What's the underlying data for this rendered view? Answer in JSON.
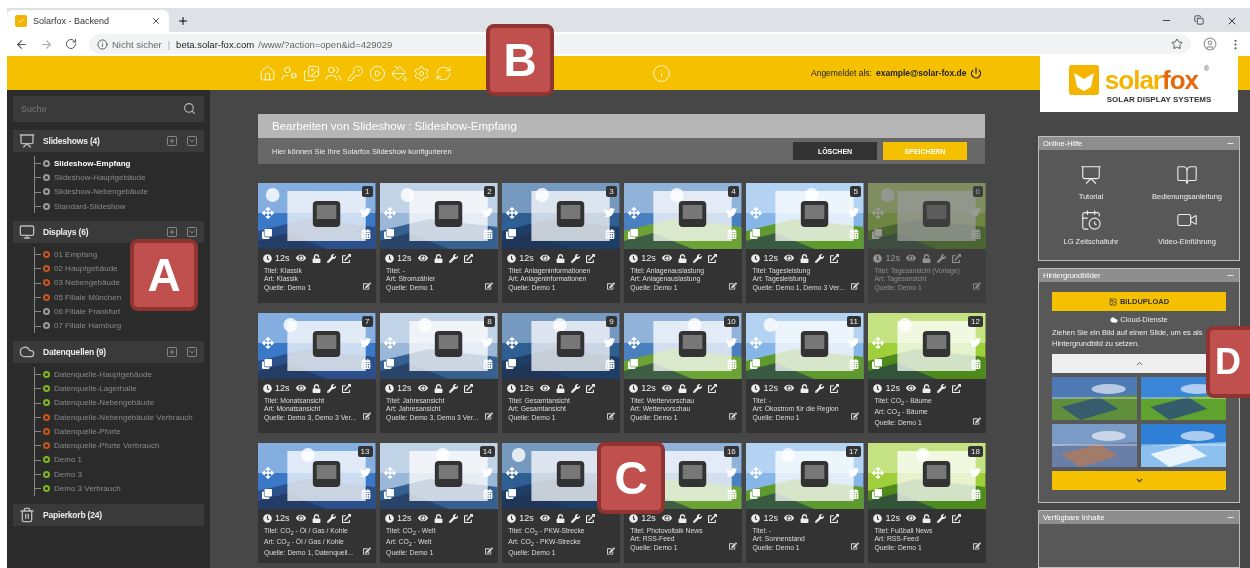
{
  "browser": {
    "tab_title": "Solarfox - Backend",
    "security": "Nicht sicher",
    "separator": "|",
    "host": "beta.solar-fox.com",
    "path": "/www/?action=open&id=429029"
  },
  "header": {
    "login_label": "Angemeldet als:",
    "login_user": "example@solar-fox.de"
  },
  "logo": {
    "brand_a": "solar",
    "brand_b": "fox",
    "mark": "®",
    "tagline": "SOLAR DISPLAY SYSTEMS"
  },
  "sidebar": {
    "search_placeholder": "Suche",
    "groups": [
      {
        "kind": "slideshows",
        "label": "Slideshows (4)",
        "items": [
          {
            "label": "Slideshow-Empfang",
            "color": "#9a9a9a",
            "selected": true
          },
          {
            "label": "Slideshow-Hauptgebäude",
            "color": "#9a9a9a",
            "selected": false
          },
          {
            "label": "Slideshow-Nebengebäude",
            "color": "#9a9a9a",
            "selected": false
          },
          {
            "label": "Standard-Slideshow",
            "color": "#9a9a9a",
            "selected": false
          }
        ]
      },
      {
        "kind": "displays",
        "label": "Displays (6)",
        "items": [
          {
            "label": "01 Empfang",
            "color": "#c8561c",
            "selected": false
          },
          {
            "label": "02 Hauptgebäude",
            "color": "#c8561c",
            "selected": false
          },
          {
            "label": "03 Nebengebäude",
            "color": "#c8561c",
            "selected": false
          },
          {
            "label": "05 Filiale München",
            "color": "#c8561c",
            "selected": false
          },
          {
            "label": "06 Filiale Frankfurt",
            "color": "#9a9a9a",
            "selected": false
          },
          {
            "label": "07 Filiale Hamburg",
            "color": "#9a9a9a",
            "selected": false
          }
        ]
      },
      {
        "kind": "datasources",
        "label": "Datenquellen (9)",
        "items": [
          {
            "label": "Datenquelle-Hauptgebäude",
            "color": "#7fb51e",
            "selected": false
          },
          {
            "label": "Datenquelle-Lagerhalle",
            "color": "#7fb51e",
            "selected": false
          },
          {
            "label": "Datenquelle-Nebengebäude",
            "color": "#7fb51e",
            "selected": false
          },
          {
            "label": "Datenquelle-Nebengebäude Verbrauch",
            "color": "#c8561c",
            "selected": false
          },
          {
            "label": "Datenquelle-Pforte",
            "color": "#c8561c",
            "selected": false
          },
          {
            "label": "Datenquelle-Pforte Verbrauch",
            "color": "#c8561c",
            "selected": false
          },
          {
            "label": "Demo 1",
            "color": "#7fb51e",
            "selected": false
          },
          {
            "label": "Demo 3",
            "color": "#7fb51e",
            "selected": false
          },
          {
            "label": "Demo 3 Verbrauch",
            "color": "#7fb51e",
            "selected": false
          }
        ]
      },
      {
        "kind": "trash",
        "label": "Papierkorb (24)"
      }
    ]
  },
  "editor": {
    "title": "Bearbeiten von Slideshow : Slideshow-Empfang",
    "subtitle": "Hier können Sie Ihre Solarfox Slideshow konfigurieren",
    "buttons": [
      {
        "kind": "delete",
        "label": "LÖSCHEN"
      },
      {
        "kind": "save",
        "label": "SPEICHERN"
      }
    ]
  },
  "slides": [
    {
      "number": "1",
      "duration": "12s",
      "title": "Titel: Klassik",
      "art": "Art: Klassik",
      "source": "Quelle: Demo 1",
      "disabled": false
    },
    {
      "number": "2",
      "duration": "12s",
      "title": "Titel: -",
      "art": "Art: Stromzähler",
      "source": "Quelle: Demo 1",
      "disabled": false
    },
    {
      "number": "3",
      "duration": "12s",
      "title": "Titel: Anlageninformationen",
      "art": "Art: Anlageninformationen",
      "source": "Quelle: Demo 1",
      "disabled": false
    },
    {
      "number": "4",
      "duration": "12s",
      "title": "Titel: Anlagenauslastung",
      "art": "Art: Anlagenauslastung",
      "source": "Quelle: Demo 1",
      "disabled": false
    },
    {
      "number": "5",
      "duration": "12s",
      "title": "Titel: Tagesleistung",
      "art": "Art: Tagesleistung",
      "source": "Quelle: Demo 1, Demo 3 Ver...",
      "disabled": false
    },
    {
      "number": "6",
      "duration": "12s",
      "title": "Titel: Tagesansicht (Vorlage)",
      "art": "Art: Tagesansicht",
      "source": "Quelle: Demo 1",
      "disabled": true
    },
    {
      "number": "7",
      "duration": "12s",
      "title": "Titel: Monatsansicht",
      "art": "Art: Monatsansicht",
      "source": "Quelle: Demo 3, Demo 3 Ver...",
      "disabled": false
    },
    {
      "number": "8",
      "duration": "12s",
      "title": "Titel: Jahresansicht",
      "art": "Art: Jahresansicht",
      "source": "Quelle: Demo 3, Demo 3 Ver...",
      "disabled": false
    },
    {
      "number": "9",
      "duration": "12s",
      "title": "Titel: Gesamtansicht",
      "art": "Art: Gesamtansicht",
      "source": "Quelle: Demo 1",
      "disabled": false
    },
    {
      "number": "10",
      "duration": "12s",
      "title": "Titel: Wettervorschau",
      "art": "Art: Wettervorschau",
      "source": "Quelle: Demo 1",
      "disabled": false
    },
    {
      "number": "11",
      "duration": "12s",
      "title": "Titel: -",
      "art": "Art: Ökostrom für die Region",
      "source": "Quelle: Demo 1",
      "disabled": false
    },
    {
      "number": "12",
      "duration": "12s",
      "title": "Titel: CO$_{2}$ - Bäume",
      "art": "Art: CO$_{2}$ - Bäume",
      "source": "Quelle: Demo 1",
      "disabled": false
    },
    {
      "number": "13",
      "duration": "12s",
      "title": "Titel: CO$_{2}$ - Öl / Gas / Kohle",
      "art": "Art: CO$_{2}$ - Öl / Gas / Kohle",
      "source": "Quelle: Demo 1, Datenquell...",
      "disabled": false
    },
    {
      "number": "14",
      "duration": "12s",
      "title": "Titel: CO$_{2}$ - Welt",
      "art": "Art: CO$_{2}$ - Welt",
      "source": "Quelle: Demo 1",
      "disabled": false
    },
    {
      "duration": "12s",
      "title": "Titel: CO$_{2}$ - PKW-Strecke",
      "art": "Art: CO$_{2}$ - PKW-Strecke",
      "source": "Quelle: Demo 1",
      "disabled": false
    },
    {
      "number": "16",
      "duration": "12s",
      "title": "Titel: Photovoltaik News",
      "art": "Art: RSS-Feed",
      "source": "Quelle: Demo 1",
      "disabled": false
    },
    {
      "number": "17",
      "duration": "12s",
      "title": "Titel: -",
      "art": "Art: Sonnenstand",
      "source": "Quelle: Demo 1",
      "disabled": false
    },
    {
      "number": "18",
      "duration": "12s",
      "title": "Titel: Fußball News",
      "art": "Art: RSS-Feed",
      "source": "Quelle: Demo 1",
      "disabled": false
    }
  ],
  "help": {
    "title": "Online-Hilfe",
    "links": [
      {
        "kind": "tutorial",
        "label": "Tutorial"
      },
      {
        "kind": "manual",
        "label": "Bedienungsanleitung"
      },
      {
        "kind": "timer",
        "label": "LG Zeitschaltuhr"
      },
      {
        "kind": "video",
        "label": "Video-Einführung"
      }
    ]
  },
  "backgrounds": {
    "title": "Hintergrundbilder",
    "upload": "BILDUPLOAD",
    "cloud": "Cloud-Dienste",
    "hint": "Ziehen Sie ein Bild auf einen Slide, um es als Hintergrundbild zu setzen."
  },
  "available": {
    "title": "Verfügbare Inhalte"
  },
  "callouts": [
    {
      "letter": "A",
      "kind": "sidebar"
    },
    {
      "letter": "B",
      "kind": "header"
    },
    {
      "letter": "C",
      "kind": "slides"
    },
    {
      "letter": "D",
      "kind": "panel"
    }
  ]
}
